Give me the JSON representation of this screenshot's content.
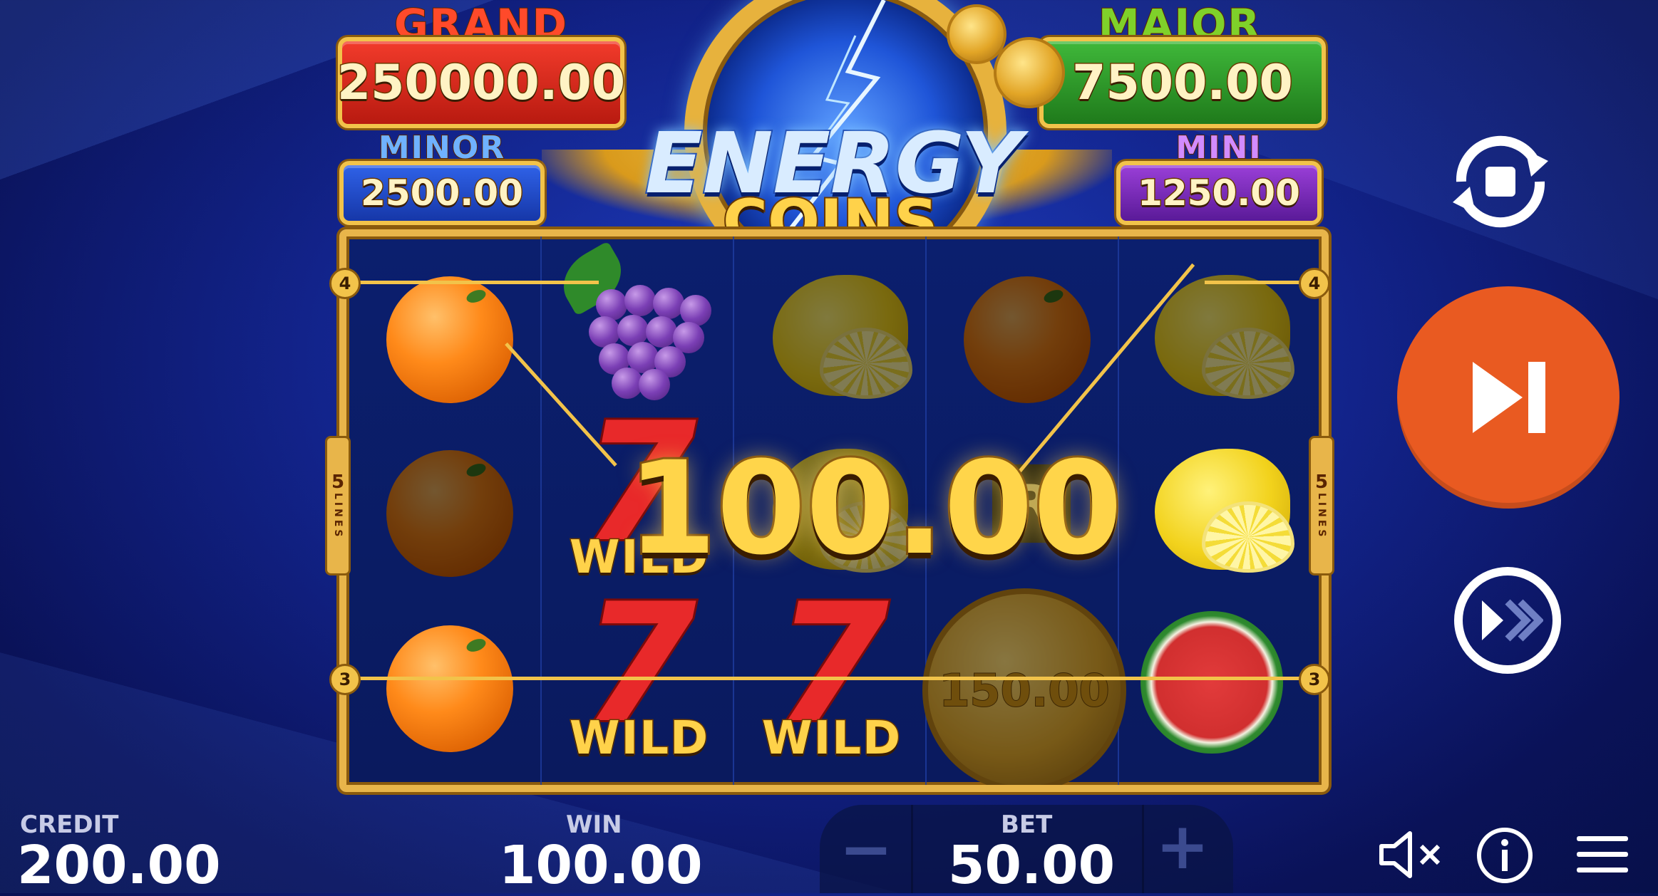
{
  "jackpots": {
    "grand": {
      "title": "GRAND",
      "value": "250000.00"
    },
    "major": {
      "title": "MAJOR",
      "value": "7500.00"
    },
    "minor": {
      "title": "MINOR",
      "value": "2500.00"
    },
    "mini": {
      "title": "MINI",
      "value": "1250.00"
    }
  },
  "logo": {
    "line1": "ENERGY",
    "line2": "COINS"
  },
  "reels": {
    "wild_label": "WILD",
    "seven_glyph": "7",
    "coin_value": "150.00",
    "bar_glyph": "R",
    "lines_count": "5",
    "lines_label": "LINES",
    "payline_left_top": "4",
    "payline_left_bottom": "3",
    "payline_right_top": "4",
    "payline_right_bottom": "3"
  },
  "win_amount": "100.00",
  "footer": {
    "credit_label": "CREDIT",
    "credit_value": "200.00",
    "win_label": "WIN",
    "win_value": "100.00",
    "bet_label": "BET",
    "bet_value": "50.00",
    "minus_glyph": "−",
    "plus_glyph": "+"
  },
  "icons": [
    "autoplay-icon",
    "skip-icon",
    "turbo-icon",
    "sound-muted-icon",
    "info-icon",
    "menu-icon"
  ],
  "colors": {
    "spin_button": "#e95a21",
    "frame_gold": "#e8b54a",
    "grand_red": "#d62a1e",
    "major_green": "#2f9a2a",
    "minor_blue": "#1f4fd6",
    "mini_purple": "#7a2fb8"
  }
}
